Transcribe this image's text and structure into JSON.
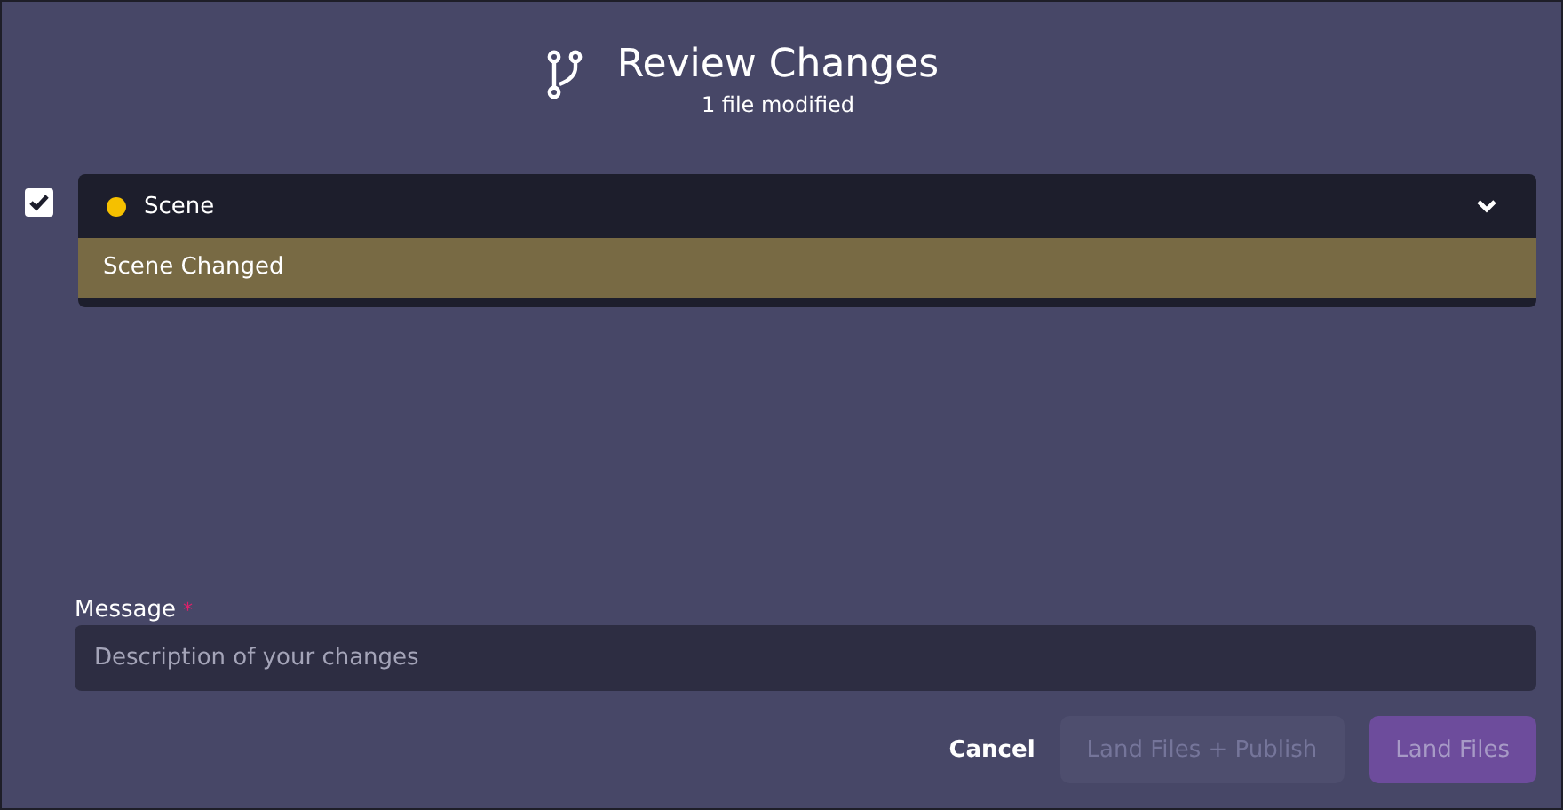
{
  "header": {
    "title": "Review Changes",
    "subtitle": "1 file modified"
  },
  "files": [
    {
      "name": "Scene",
      "checked": true,
      "expanded": true,
      "color": "#f5c000",
      "changes": [
        "Scene Changed"
      ]
    }
  ],
  "message": {
    "label": "Message",
    "required_mark": "*",
    "placeholder": "Description of your changes"
  },
  "buttons": [
    {
      "label": "Cancel",
      "kind": "link",
      "disabled": false
    },
    {
      "label": "Land Files + Publish",
      "kind": "secondary",
      "disabled": true
    },
    {
      "label": "Land Files",
      "kind": "primary",
      "disabled": true
    }
  ]
}
